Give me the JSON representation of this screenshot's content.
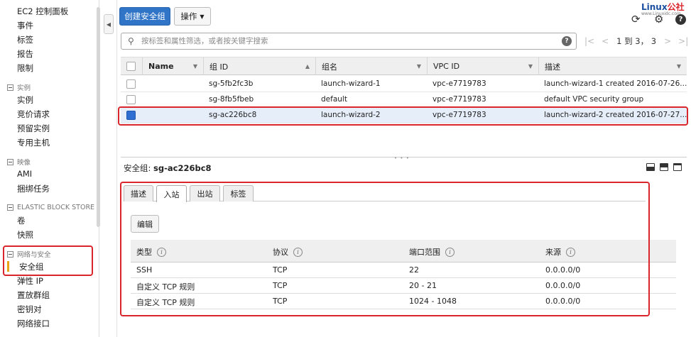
{
  "sidebar": {
    "top_items": [
      "EC2 控制面板",
      "事件",
      "标签",
      "报告",
      "限制"
    ],
    "sections": [
      {
        "title": "实例",
        "items": [
          "实例",
          "竞价请求",
          "预留实例",
          "专用主机"
        ]
      },
      {
        "title": "映像",
        "items": [
          "AMI",
          "捆绑任务"
        ]
      },
      {
        "title": "ELASTIC BLOCK STORE",
        "items": [
          "卷",
          "快照"
        ]
      },
      {
        "title": "网络与安全",
        "items": [
          "安全组",
          "弹性 IP",
          "置放群组",
          "密钥对",
          "网络接口"
        ]
      }
    ],
    "active_item": "安全组",
    "accent_color": "#e8a317"
  },
  "toolbar": {
    "create_label": "创建安全组",
    "actions_label": "操作",
    "primary_color": "#2f74c7",
    "icons": [
      "refresh-icon",
      "gear-icon",
      "help-icon"
    ]
  },
  "logo": {
    "text_main": "Linux",
    "text_accent": "公社",
    "text_sub": "www.Linuxidc.com"
  },
  "search": {
    "placeholder": "按标签和属性筛选，或者按关键字搜索",
    "value": ""
  },
  "pager": {
    "text": "1 到 3， 3"
  },
  "table": {
    "columns": [
      "Name",
      "组 ID",
      "组名",
      "VPC ID",
      "描述"
    ],
    "rows": [
      {
        "name": "",
        "group_id": "sg-5fb2fc3b",
        "group_name": "launch-wizard-1",
        "vpc_id": "vpc-e7719783",
        "description": "launch-wizard-1 created 2016-07-26...",
        "selected": false
      },
      {
        "name": "",
        "group_id": "sg-8fb5fbeb",
        "group_name": "default",
        "vpc_id": "vpc-e7719783",
        "description": "default VPC security group",
        "selected": false
      },
      {
        "name": "",
        "group_id": "sg-ac226bc8",
        "group_name": "launch-wizard-2",
        "vpc_id": "vpc-e7719783",
        "description": "launch-wizard-2 created 2016-07-27...",
        "selected": true
      }
    ],
    "highlight_color": "#d9262c"
  },
  "details": {
    "title_prefix": "安全组:",
    "title_value": "sg-ac226bc8",
    "tabs": [
      "描述",
      "入站",
      "出站",
      "标签"
    ],
    "active_tab": "入站",
    "edit_label": "编辑",
    "rules_columns": [
      "类型",
      "协议",
      "端口范围",
      "来源"
    ],
    "rules": [
      {
        "type": "SSH",
        "protocol": "TCP",
        "port_range": "22",
        "source": "0.0.0.0/0"
      },
      {
        "type": "自定义 TCP 规则",
        "protocol": "TCP",
        "port_range": "20 - 21",
        "source": "0.0.0.0/0"
      },
      {
        "type": "自定义 TCP 规则",
        "protocol": "TCP",
        "port_range": "1024 - 1048",
        "source": "0.0.0.0/0"
      }
    ]
  }
}
